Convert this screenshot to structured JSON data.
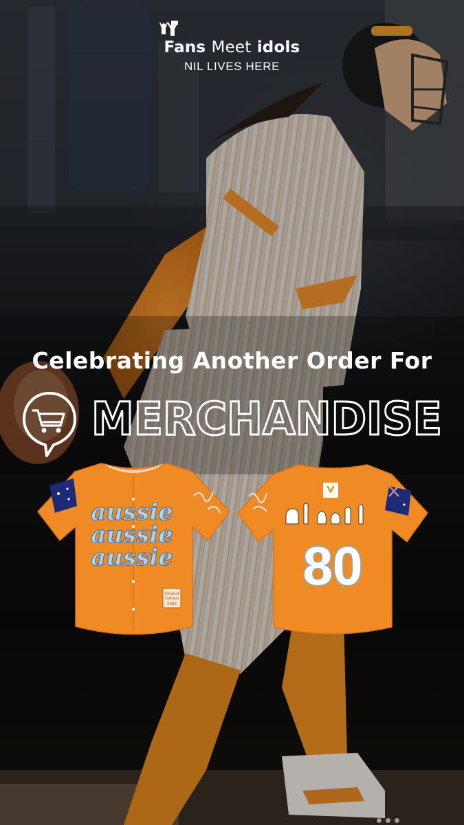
{
  "brand": {
    "name_part1": "Fans",
    "name_part2": "Meet",
    "name_part3": "idols",
    "tagline": "NIL LIVES HERE",
    "logo_icon": "people-cheering-icon"
  },
  "headline": "Celebrating Another Order For",
  "category": {
    "label": "MERCHANDISE",
    "icon": "shopping-cart-icon"
  },
  "product": {
    "front_script_lines": [
      "aussie",
      "aussie",
      "aussie"
    ],
    "patch_text": [
      "Limited",
      "Edition",
      "2025"
    ],
    "back_number": "80",
    "flag_icon": "australia-flag-icon",
    "hand_signs_icon": "asl-hand-signs-icon"
  },
  "colors": {
    "jersey_orange": "#f08a24",
    "script_light_blue": "#a9d4f2",
    "text_white": "#ffffff",
    "background_dark": "#0d0c0b"
  }
}
